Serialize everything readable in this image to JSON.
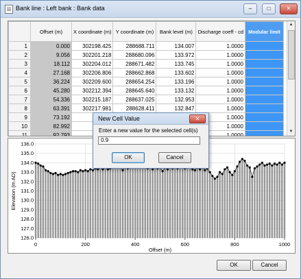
{
  "window": {
    "title": "Bank line : Left bank : Bank data",
    "min": "–",
    "max": "□",
    "close": "✕"
  },
  "table": {
    "columns": [
      "",
      "Offset (m)",
      "X coordinate (m)",
      "Y coordinate (m)",
      "Bank level (m)",
      "Discharge coeff - cd",
      "Modular limit"
    ],
    "rows": [
      [
        "1",
        "0.000",
        "302198.425",
        "288688.711",
        "134.007",
        "1.0000",
        ""
      ],
      [
        "2",
        "9.056",
        "302201.218",
        "288680.096",
        "133.972",
        "1.0000",
        ""
      ],
      [
        "3",
        "18.112",
        "302204.012",
        "288671.482",
        "133.745",
        "1.0000",
        ""
      ],
      [
        "4",
        "27.168",
        "302206.806",
        "288662.868",
        "133.602",
        "1.0000",
        ""
      ],
      [
        "5",
        "36.224",
        "302209.600",
        "288654.254",
        "133.196",
        "1.0000",
        ""
      ],
      [
        "6",
        "45.280",
        "302212.394",
        "288645.640",
        "133.132",
        "1.0000",
        ""
      ],
      [
        "7",
        "54.336",
        "302215.187",
        "288637.025",
        "132.953",
        "1.0000",
        ""
      ],
      [
        "8",
        "63.391",
        "302217.981",
        "288628.411",
        "132.847",
        "1.0000",
        ""
      ],
      [
        "9",
        "73.192",
        "30222",
        "",
        "",
        "1.0000",
        ""
      ],
      [
        "10",
        "82.992",
        "30222",
        "",
        "",
        "1.0000",
        ""
      ],
      [
        "11",
        "92.793",
        "30222",
        "",
        "",
        "1.0000",
        ""
      ]
    ]
  },
  "chart_data": {
    "type": "bar",
    "xlabel": "Offset (m)",
    "ylabel": "Elevation (m AD)",
    "xlim": [
      0,
      1000
    ],
    "ylim": [
      126,
      136
    ],
    "xticks": [
      "0",
      "200",
      "400",
      "600",
      "800",
      "1000"
    ],
    "yticks": [
      "126.0",
      "127.0",
      "128.0",
      "129.0",
      "130.0",
      "131.0",
      "132.0",
      "133.0",
      "134.0",
      "135.0",
      "136.0"
    ],
    "x": [
      0,
      10,
      20,
      30,
      40,
      50,
      60,
      70,
      80,
      90,
      100,
      110,
      120,
      130,
      140,
      150,
      160,
      170,
      180,
      190,
      200,
      210,
      220,
      230,
      240,
      250,
      260,
      270,
      280,
      290,
      300,
      310,
      320,
      330,
      340,
      350,
      360,
      370,
      380,
      390,
      400,
      410,
      420,
      430,
      440,
      450,
      460,
      470,
      480,
      490,
      500,
      510,
      520,
      530,
      540,
      550,
      560,
      570,
      580,
      590,
      600,
      610,
      620,
      630,
      640,
      650,
      660,
      670,
      680,
      690,
      700,
      710,
      720,
      730,
      740,
      750,
      760,
      770,
      780,
      790,
      800,
      810,
      820,
      830,
      840,
      850,
      860,
      870,
      880,
      890,
      900,
      910,
      920,
      930,
      940,
      950,
      960,
      970,
      980,
      990,
      1000
    ],
    "values": [
      134.0,
      133.9,
      133.7,
      133.6,
      133.2,
      133.1,
      132.9,
      132.8,
      132.9,
      132.7,
      132.8,
      132.7,
      132.8,
      132.9,
      133.0,
      133.1,
      133.1,
      133.0,
      133.2,
      133.1,
      133.2,
      133.1,
      133.3,
      133.2,
      133.4,
      133.3,
      133.5,
      133.3,
      133.5,
      133.3,
      133.4,
      133.6,
      133.8,
      134.3,
      133.6,
      133.2,
      133.6,
      133.4,
      133.6,
      133.8,
      133.6,
      134.0,
      133.6,
      134.0,
      133.5,
      133.4,
      133.7,
      133.3,
      133.8,
      133.4,
      133.5,
      133.1,
      133.5,
      133.3,
      133.5,
      133.4,
      133.6,
      133.4,
      133.7,
      133.6,
      133.4,
      133.9,
      133.6,
      133.3,
      133.2,
      133.5,
      133.3,
      133.7,
      133.2,
      133.4,
      133.0,
      132.6,
      132.3,
      132.5,
      133.0,
      132.8,
      133.3,
      133.5,
      133.0,
      132.7,
      133.1,
      133.6,
      134.1,
      134.4,
      134.2,
      133.7,
      133.5,
      132.5,
      133.4,
      133.6,
      133.8,
      134.0,
      133.7,
      133.8,
      133.9,
      133.7,
      133.9,
      133.8,
      134.0,
      133.8,
      134.0
    ],
    "grid": true
  },
  "dialog": {
    "title": "New Cell Value",
    "prompt": "Enter a new value for the selected cell(s)",
    "value": "0.9",
    "ok": "OK",
    "cancel": "Cancel",
    "close": "✕"
  },
  "footer": {
    "ok": "OK",
    "cancel": "Cancel"
  }
}
